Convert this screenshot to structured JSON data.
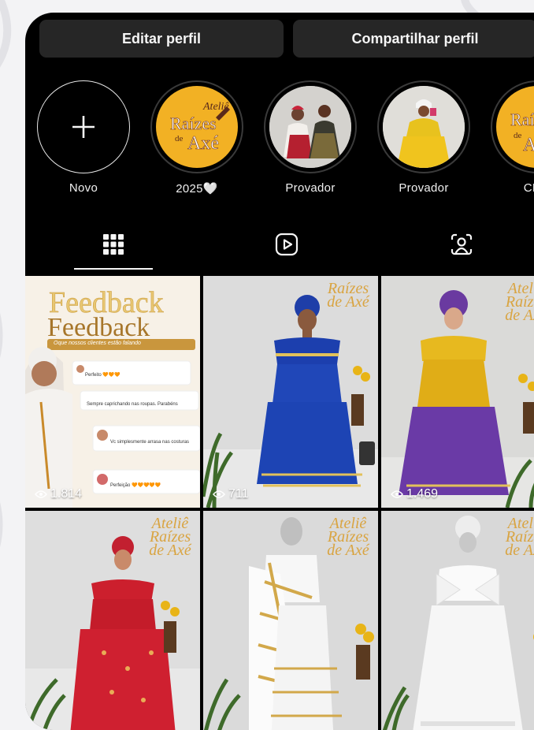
{
  "profile_buttons": {
    "edit": "Editar perfil",
    "share": "Compartilhar perfil"
  },
  "highlights": [
    {
      "label": "Novo",
      "type": "new"
    },
    {
      "label": "2025🤍",
      "type": "logo",
      "logo_text": "Ateliê Raízes de Axé"
    },
    {
      "label": "Provador",
      "type": "photo"
    },
    {
      "label": "Provador",
      "type": "photo"
    },
    {
      "label": "CLIE",
      "type": "logo",
      "logo_text": "Raízes de"
    }
  ],
  "tabs": [
    {
      "name": "posts",
      "icon": "grid-icon",
      "active": true
    },
    {
      "name": "reels",
      "icon": "reels-icon",
      "active": false
    },
    {
      "name": "tagged",
      "icon": "tagged-person-icon",
      "active": false
    }
  ],
  "posts": [
    {
      "views": "1.814",
      "feedback_title": "Feedback",
      "feedback_subtitle": "Oque nossos clientes estão falando",
      "comments": [
        "Perfeito 🧡🧡🧡",
        "Sempre caprichando nas roupas. Parabéns",
        "Vc simplesmente arrasa nas costuras",
        "Perfeição 🧡🧡🧡🧡🧡"
      ]
    },
    {
      "views": "711",
      "watermark": "Raízes de Axé"
    },
    {
      "views": "1.469",
      "watermark": "Ateliê Raízes de Axé"
    },
    {
      "views": "",
      "watermark": "Ateliê Raízes de Axé"
    },
    {
      "views": "",
      "watermark": "Ateliê Raízes de Axé"
    },
    {
      "views": "",
      "watermark": "Ateliê Raízes de Axé"
    }
  ],
  "colors": {
    "background": "#000000",
    "button": "#262626",
    "brand_yellow": "#f2b124"
  }
}
